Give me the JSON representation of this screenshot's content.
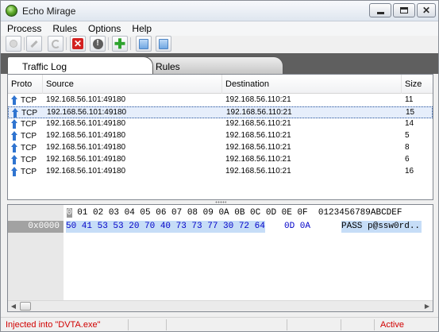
{
  "window": {
    "title": "Echo Mirage"
  },
  "menu": [
    "Process",
    "Rules",
    "Options",
    "Help"
  ],
  "toolbar": {
    "icons": [
      "disabled-circle-icon",
      "pencil-icon",
      "refresh-icon",
      "delete-icon",
      "stop-icon",
      "add-icon",
      "blue-page-icon",
      "blue-page-icon"
    ]
  },
  "tabs": [
    {
      "label": "Traffic Log",
      "active": true
    },
    {
      "label": "Rules",
      "active": false
    }
  ],
  "traffic": {
    "columns": [
      "Proto",
      "Source",
      "Destination",
      "Size"
    ],
    "rows": [
      {
        "proto": "TCP",
        "source": "192.168.56.101:49180",
        "destination": "192.168.56.110:21",
        "size": "11",
        "selected": false
      },
      {
        "proto": "TCP",
        "source": "192.168.56.101:49180",
        "destination": "192.168.56.110:21",
        "size": "15",
        "selected": true
      },
      {
        "proto": "TCP",
        "source": "192.168.56.101:49180",
        "destination": "192.168.56.110:21",
        "size": "14",
        "selected": false
      },
      {
        "proto": "TCP",
        "source": "192.168.56.101:49180",
        "destination": "192.168.56.110:21",
        "size": "5",
        "selected": false
      },
      {
        "proto": "TCP",
        "source": "192.168.56.101:49180",
        "destination": "192.168.56.110:21",
        "size": "8",
        "selected": false
      },
      {
        "proto": "TCP",
        "source": "192.168.56.101:49180",
        "destination": "192.168.56.110:21",
        "size": "6",
        "selected": false
      },
      {
        "proto": "TCP",
        "source": "192.168.56.101:49180",
        "destination": "192.168.56.110:21",
        "size": "16",
        "selected": false
      }
    ]
  },
  "hex": {
    "header_caret": "0",
    "header": "0 01 02 03 04 05 06 07 08 09 0A 0B 0C 0D 0E 0F  0123456789ABCDEF",
    "offset": "0x0000",
    "bytes_selected": "50 41 53 53 20 70 40 73 73 77 30 72 64",
    "bytes_rest": "0D 0A",
    "ascii": "PASS p@ssw0rd.."
  },
  "status": {
    "left": "Injected into \"DVTA.exe\"",
    "right": "Active"
  }
}
